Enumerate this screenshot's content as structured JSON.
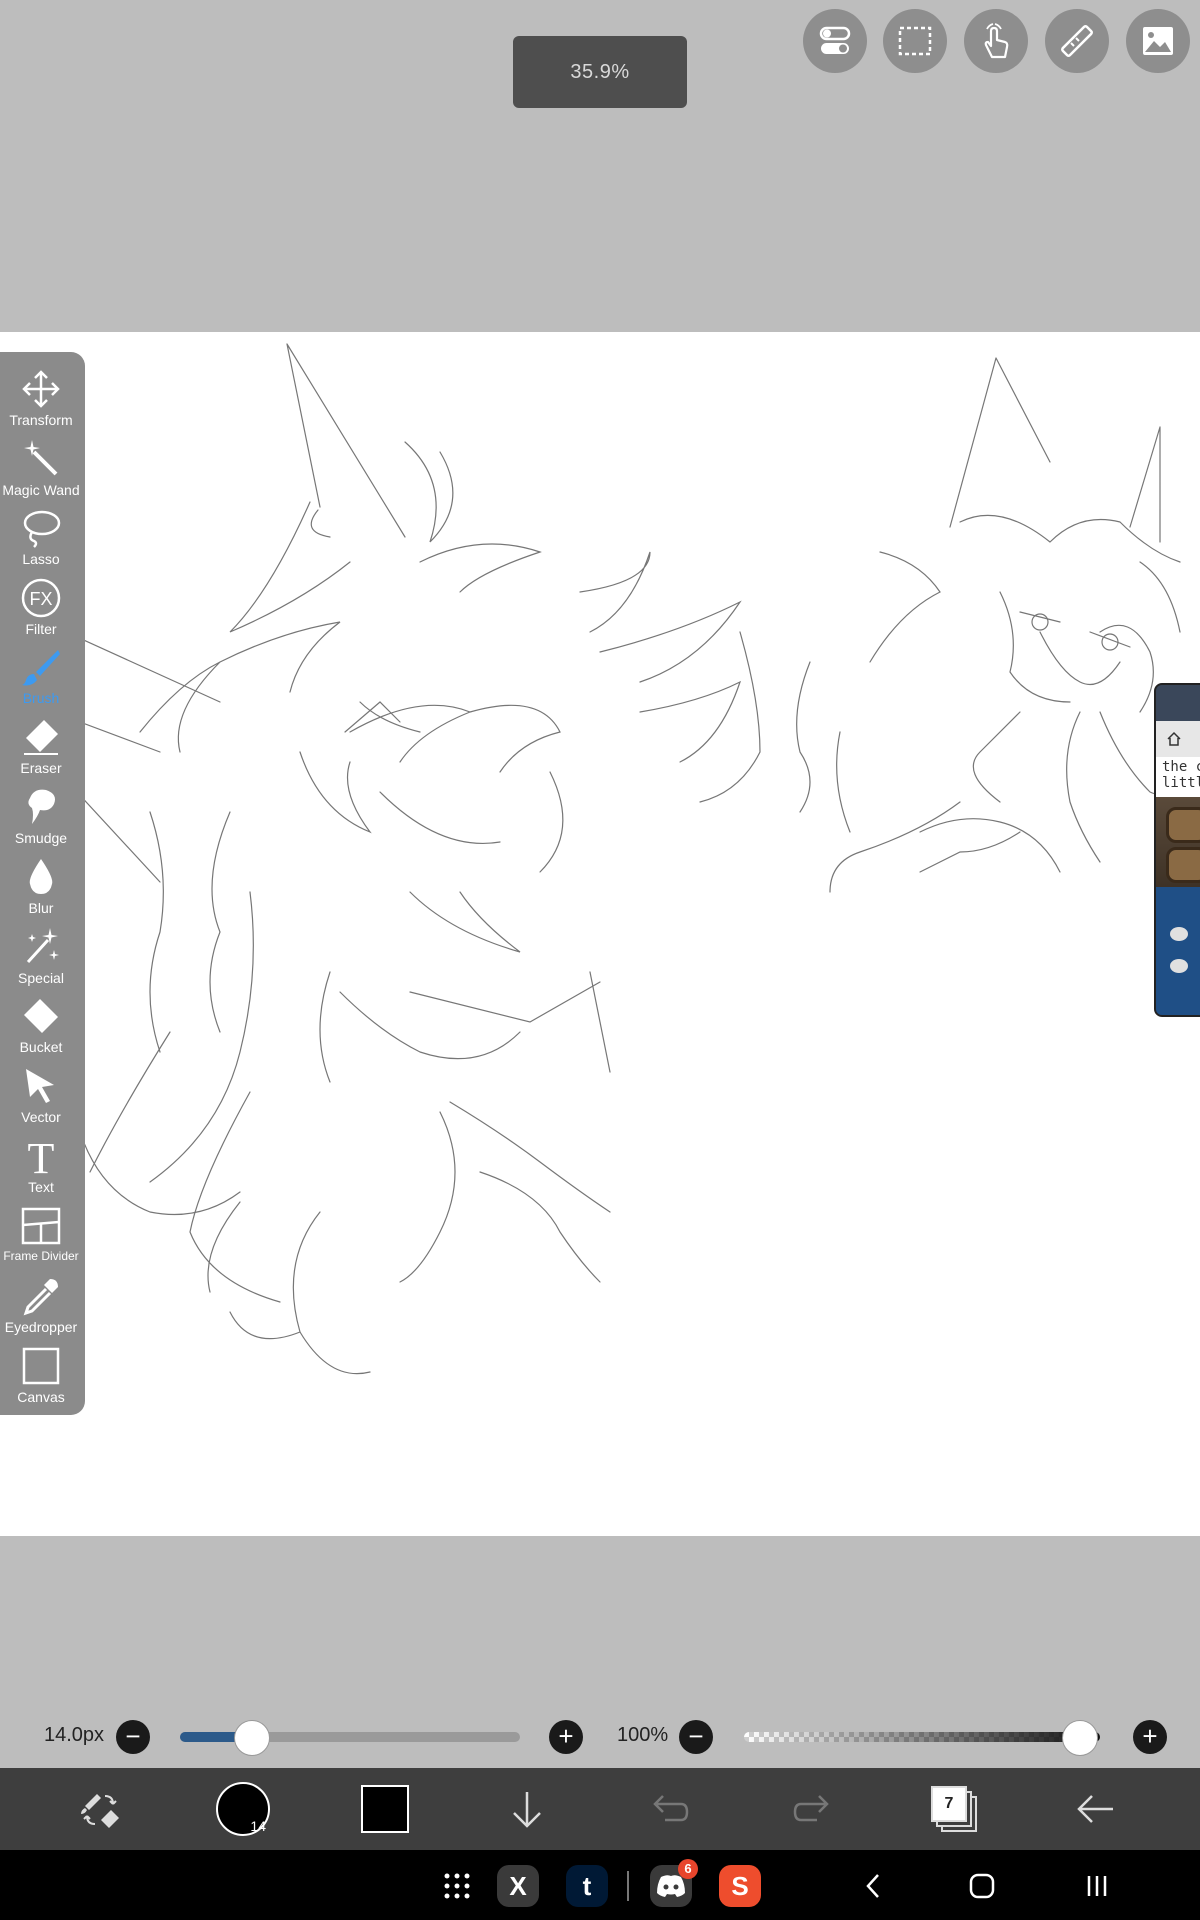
{
  "zoom": {
    "value": "35.9%"
  },
  "top_controls": [
    {
      "id": "toggle",
      "icon": "toggle-switch-icon"
    },
    {
      "id": "selection",
      "icon": "selection-rect-icon"
    },
    {
      "id": "touch",
      "icon": "hand-touch-icon"
    },
    {
      "id": "ruler",
      "icon": "ruler-icon"
    },
    {
      "id": "reference",
      "icon": "image-icon"
    }
  ],
  "tools": [
    {
      "label": "Transform",
      "icon": "move-arrows-icon"
    },
    {
      "label": "Magic Wand",
      "icon": "magic-wand-icon"
    },
    {
      "label": "Lasso",
      "icon": "lasso-icon"
    },
    {
      "label": "Filter",
      "icon": "fx-icon"
    },
    {
      "label": "Brush",
      "icon": "brush-icon",
      "active": true
    },
    {
      "label": "Eraser",
      "icon": "eraser-icon"
    },
    {
      "label": "Smudge",
      "icon": "smudge-icon"
    },
    {
      "label": "Blur",
      "icon": "drop-icon"
    },
    {
      "label": "Special",
      "icon": "sparkle-icon"
    },
    {
      "label": "Bucket",
      "icon": "bucket-icon"
    },
    {
      "label": "Vector",
      "icon": "pointer-icon"
    },
    {
      "label": "Text",
      "icon": "text-icon"
    },
    {
      "label": "Frame Divider",
      "icon": "frame-divider-icon"
    },
    {
      "label": "Eyedropper",
      "icon": "eyedropper-icon"
    },
    {
      "label": "Canvas",
      "icon": "canvas-icon"
    }
  ],
  "brush_size": {
    "label": "14.0px",
    "fraction": 0.21,
    "minus": "−",
    "plus": "+"
  },
  "opacity": {
    "label": "100%",
    "fraction": 1.0,
    "minus": "−",
    "plus": "+"
  },
  "bottom_bar": {
    "brush_size_preview": "14",
    "layer_count": "7",
    "color": "#000000"
  },
  "floating_window": {
    "text_line1": "the c",
    "text_line2": "little"
  },
  "system_bar": {
    "discord_badge": "6",
    "apps": [
      {
        "name": "X",
        "label": "X",
        "color": "#3a3a3a"
      },
      {
        "name": "tumblr",
        "label": "t",
        "color": "#001935"
      },
      {
        "name": "discord",
        "label": "",
        "color": "#3a3a3a"
      },
      {
        "name": "shopee",
        "label": "S",
        "color": "#ee4d2d"
      }
    ]
  },
  "colors": {
    "accent": "#3d9af0",
    "toolbar_bg": "#8b8b8b",
    "bottom_bar_bg": "#3e3e3e",
    "workspace_bg": "#bdbdbd"
  }
}
